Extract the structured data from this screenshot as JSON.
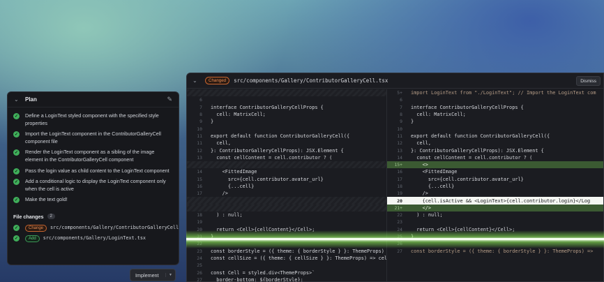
{
  "plan": {
    "title": "Plan",
    "steps": [
      {
        "text": "Define a LoginText styled component with the specified style properties"
      },
      {
        "text": "Import the LoginText component in the ContributorGalleryCell component file"
      },
      {
        "text": "Render the LoginText component as a sibling of the image element in the ContributorGalleryCell component"
      },
      {
        "text": "Pass the login value as child content to the LoginText component"
      },
      {
        "text": "Add a conditional logic to display the LoginText component only when the cell is active"
      },
      {
        "text": "Make the text gold!"
      }
    ],
    "file_changes_label": "File changes",
    "file_changes_count": "2",
    "files": [
      {
        "badge": "Change",
        "path": "src/components/Gallery/ContributorGalleryCell.tsx"
      },
      {
        "badge": "Add",
        "path": "src/components/Gallery/LoginText.tsx"
      }
    ],
    "implement_label": "Implement"
  },
  "diff": {
    "status_badge": "Changed",
    "file_path": "src/components/Gallery/ContributorGalleryCell.tsx",
    "dismiss_label": "Dismiss",
    "left": [
      {
        "ln": "",
        "code": "",
        "kind": "hatch"
      },
      {
        "ln": "6",
        "code": "",
        "kind": ""
      },
      {
        "ln": "7",
        "code": "interface ContributorGalleryCellProps {",
        "kind": ""
      },
      {
        "ln": "8",
        "code": "  cell: MatrixCell;",
        "kind": ""
      },
      {
        "ln": "9",
        "code": "}",
        "kind": ""
      },
      {
        "ln": "10",
        "code": "",
        "kind": ""
      },
      {
        "ln": "11",
        "code": "export default function ContributorGalleryCell({",
        "kind": ""
      },
      {
        "ln": "11",
        "code": "  cell,",
        "kind": ""
      },
      {
        "ln": "12",
        "code": "}: ContributorGalleryCellProps): JSX.Element {",
        "kind": ""
      },
      {
        "ln": "13",
        "code": "  const cellContent = cell.contributor ? (",
        "kind": ""
      },
      {
        "ln": "",
        "code": "",
        "kind": "hatch"
      },
      {
        "ln": "14",
        "code": "    <FittedImage",
        "kind": ""
      },
      {
        "ln": "15",
        "code": "      src={cell.contributor.avatar_url}",
        "kind": ""
      },
      {
        "ln": "16",
        "code": "      {...cell}",
        "kind": ""
      },
      {
        "ln": "17",
        "code": "    />",
        "kind": ""
      },
      {
        "ln": "",
        "code": "",
        "kind": "hatch"
      },
      {
        "ln": "",
        "code": "",
        "kind": "hatch"
      },
      {
        "ln": "18",
        "code": "  ) : null;",
        "kind": ""
      },
      {
        "ln": "19",
        "code": "",
        "kind": ""
      },
      {
        "ln": "20",
        "code": "  return <Cell>{cellContent}</Cell>;",
        "kind": ""
      },
      {
        "ln": "21",
        "code": "}",
        "kind": ""
      },
      {
        "ln": "22",
        "code": "",
        "kind": ""
      },
      {
        "ln": "23",
        "code": "const borderStyle = ({ theme: { borderStyle } }: ThemeProps) =>",
        "kind": ""
      },
      {
        "ln": "24",
        "code": "const cellSize = ({ theme: { cellSize } }: ThemeProps) => cellSi",
        "kind": ""
      },
      {
        "ln": "25",
        "code": "",
        "kind": ""
      },
      {
        "ln": "26",
        "code": "const Cell = styled.div<ThemeProps>`",
        "kind": ""
      },
      {
        "ln": "27",
        "code": "  border-bottom: ${borderStyle};",
        "kind": ""
      }
    ],
    "right": [
      {
        "ln": "5+",
        "code": "import LoginText from \"./LoginText\"; // Import the LoginText com",
        "kind": "removed-dim"
      },
      {
        "ln": "6",
        "code": "",
        "kind": ""
      },
      {
        "ln": "7",
        "code": "interface ContributorGalleryCellProps {",
        "kind": ""
      },
      {
        "ln": "8",
        "code": "  cell: MatrixCell;",
        "kind": ""
      },
      {
        "ln": "9",
        "code": "}",
        "kind": ""
      },
      {
        "ln": "10",
        "code": "",
        "kind": ""
      },
      {
        "ln": "11",
        "code": "export default function ContributorGalleryCell({",
        "kind": ""
      },
      {
        "ln": "12",
        "code": "  cell,",
        "kind": ""
      },
      {
        "ln": "13",
        "code": "}: ContributorGalleryCellProps): JSX.Element {",
        "kind": ""
      },
      {
        "ln": "14",
        "code": "  const cellContent = cell.contributor ? (",
        "kind": ""
      },
      {
        "ln": "15+",
        "code": "    <>",
        "kind": "added"
      },
      {
        "ln": "16",
        "code": "    <FittedImage",
        "kind": ""
      },
      {
        "ln": "17",
        "code": "      src={cell.contributor.avatar_url}",
        "kind": ""
      },
      {
        "ln": "18",
        "code": "      {...cell}",
        "kind": ""
      },
      {
        "ln": "19",
        "code": "    />",
        "kind": ""
      },
      {
        "ln": "20",
        "code": "    {cell.isActive && <LoginText>{cell.contributor.login}</Log",
        "kind": "changed-bright"
      },
      {
        "ln": "21+",
        "code": "    </>",
        "kind": "added"
      },
      {
        "ln": "22",
        "code": "  ) : null;",
        "kind": ""
      },
      {
        "ln": "23",
        "code": "",
        "kind": ""
      },
      {
        "ln": "24",
        "code": "  return <Cell>{cellContent}</Cell>;",
        "kind": ""
      },
      {
        "ln": "25",
        "code": "}",
        "kind": ""
      },
      {
        "ln": "26",
        "code": "",
        "kind": ""
      },
      {
        "ln": "27",
        "code": "const borderStyle = ({ theme: { borderStyle } }: ThemeProps) =>",
        "kind": "removed-dim"
      }
    ]
  }
}
